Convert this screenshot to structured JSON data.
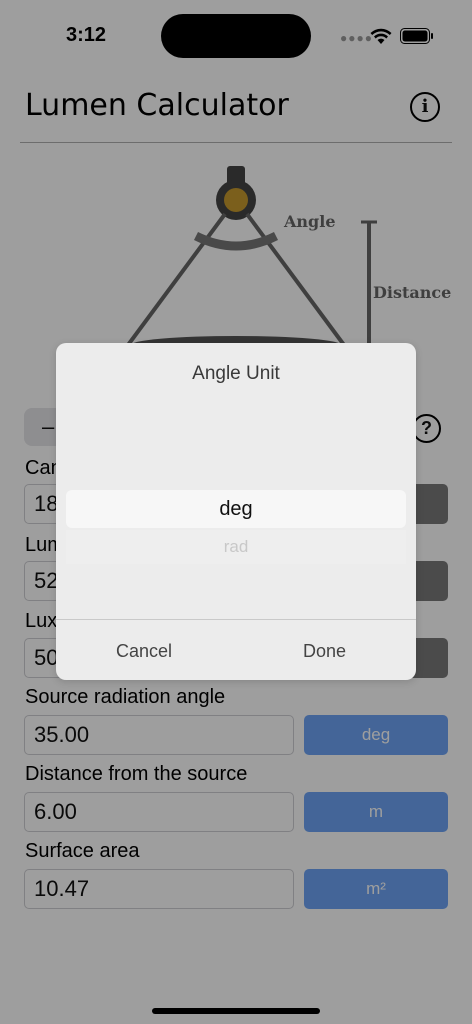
{
  "status": {
    "time": "3:12"
  },
  "app": {
    "title": "Lumen Calculator"
  },
  "diagram": {
    "angle_label": "Angle",
    "distance_label": "Distance"
  },
  "segment": {
    "label": "–"
  },
  "fields": [
    {
      "label": "Can",
      "value": "18",
      "unit": ""
    },
    {
      "label": "Lum",
      "value": "52",
      "unit": ""
    },
    {
      "label": "Lux",
      "value": "50",
      "unit": ""
    },
    {
      "label": "Source radiation angle",
      "value": "35.00",
      "unit": "deg"
    },
    {
      "label": "Distance from the source",
      "value": "6.00",
      "unit": "m"
    },
    {
      "label": "Surface area",
      "value": "10.47",
      "unit": "m²"
    }
  ],
  "picker": {
    "title": "Angle Unit",
    "options": [
      "deg",
      "rad"
    ],
    "selected": "deg",
    "cancel_label": "Cancel",
    "done_label": "Done"
  },
  "colors": {
    "unit_button": "#6fa4f5",
    "bulb": "#c79a2e"
  }
}
